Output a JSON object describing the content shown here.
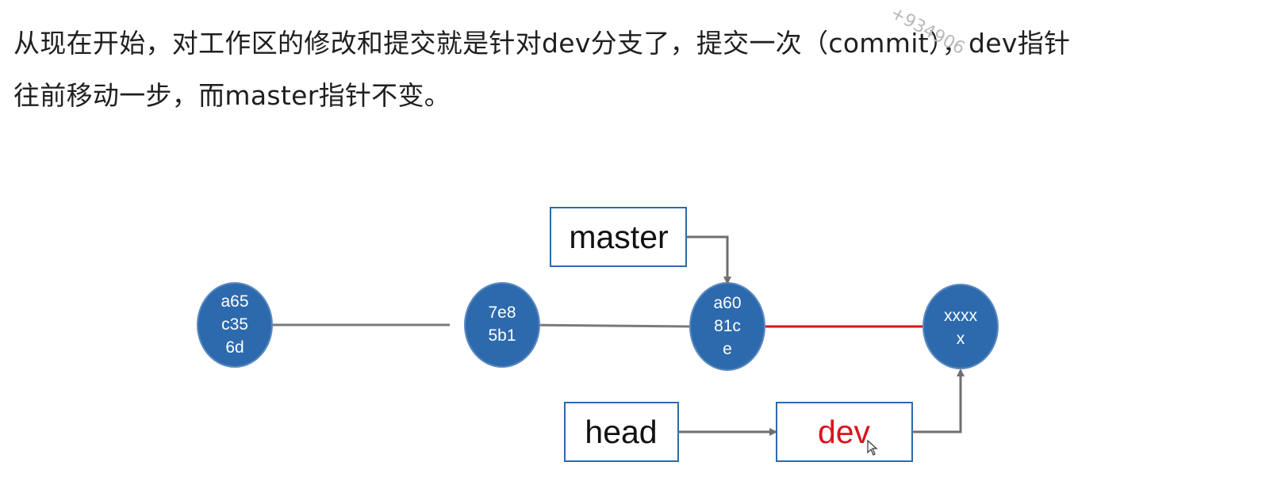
{
  "paragraph": {
    "line1": "从现在开始，对工作区的修改和提交就是针对dev分支了，提交一次（commit），dev指针",
    "line2": "往前移动一步，而master指针不变。"
  },
  "watermark": "+934906",
  "diagram": {
    "commits": [
      {
        "id": "c1",
        "lines": [
          "a65",
          "c35",
          "6d"
        ]
      },
      {
        "id": "c2",
        "lines": [
          "7e8",
          "5b1"
        ]
      },
      {
        "id": "c3",
        "lines": [
          "a60",
          "81c",
          "e"
        ]
      },
      {
        "id": "c4",
        "lines": [
          "xxxx",
          "x"
        ]
      }
    ],
    "labels": {
      "master": "master",
      "head": "head",
      "dev": "dev"
    },
    "colors": {
      "commit_fill": "#2d6aad",
      "commit_stroke": "#5b89c0",
      "line_main": "#7a7a7a",
      "line_new": "#d8141c",
      "dev_text": "#d8141c",
      "box_border": "#2d6aad",
      "arrow": "#6f6f6f"
    }
  }
}
